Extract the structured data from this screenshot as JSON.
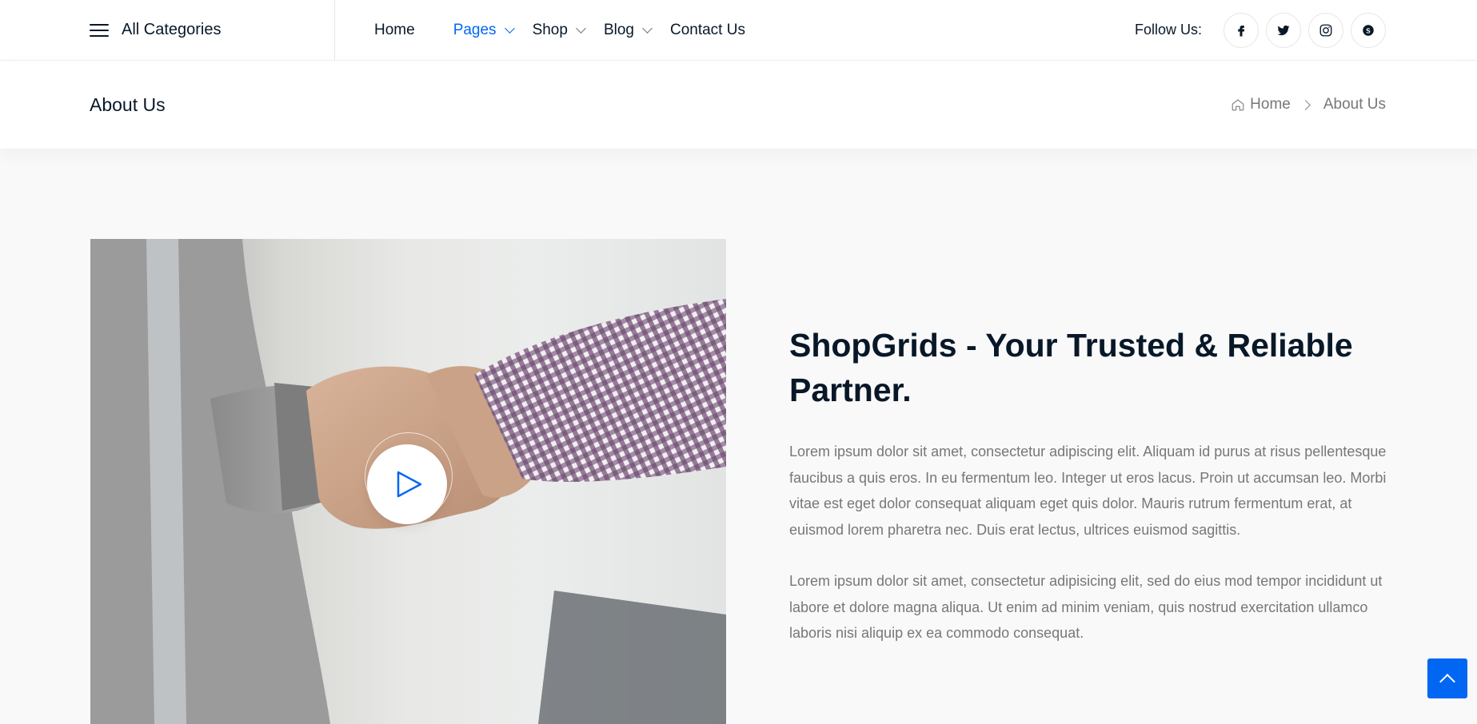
{
  "topnav": {
    "categories_label": "All Categories",
    "menu": [
      {
        "label": "Home"
      },
      {
        "label": "Pages"
      },
      {
        "label": "Shop"
      },
      {
        "label": "Blog"
      },
      {
        "label": "Contact Us"
      }
    ],
    "active_item": "Pages",
    "follow_label": "Follow Us:",
    "social": [
      "facebook-icon",
      "twitter-icon",
      "instagram-icon",
      "skype-icon"
    ]
  },
  "breadcrumb": {
    "page_title": "About Us",
    "home": "Home",
    "current": "About Us"
  },
  "about": {
    "title": "ShopGrids - Your Trusted & Reliable Partner.",
    "paragraph_1": "Lorem ipsum dolor sit amet, consectetur adipiscing elit. Aliquam id purus at risus pellentesque faucibus a quis eros. In eu fermentum leo. Integer ut eros lacus. Proin ut accumsan leo. Morbi vitae est eget dolor consequat aliquam eget quis dolor. Mauris rutrum fermentum erat, at euismod lorem pharetra nec. Duis erat lectus, ultrices euismod sagittis.",
    "paragraph_2": "Lorem ipsum dolor sit amet, consectetur adipisicing elit, sed do eius mod tempor incididunt ut labore et dolore magna aliqua. Ut enim ad minim veniam, quis nostrud exercitation ullamco laboris nisi aliquip ex ea commodo consequat."
  },
  "colors": {
    "accent": "#0167f3",
    "heading": "#081828",
    "body_text": "#777777",
    "background": "#f9f9f9"
  }
}
